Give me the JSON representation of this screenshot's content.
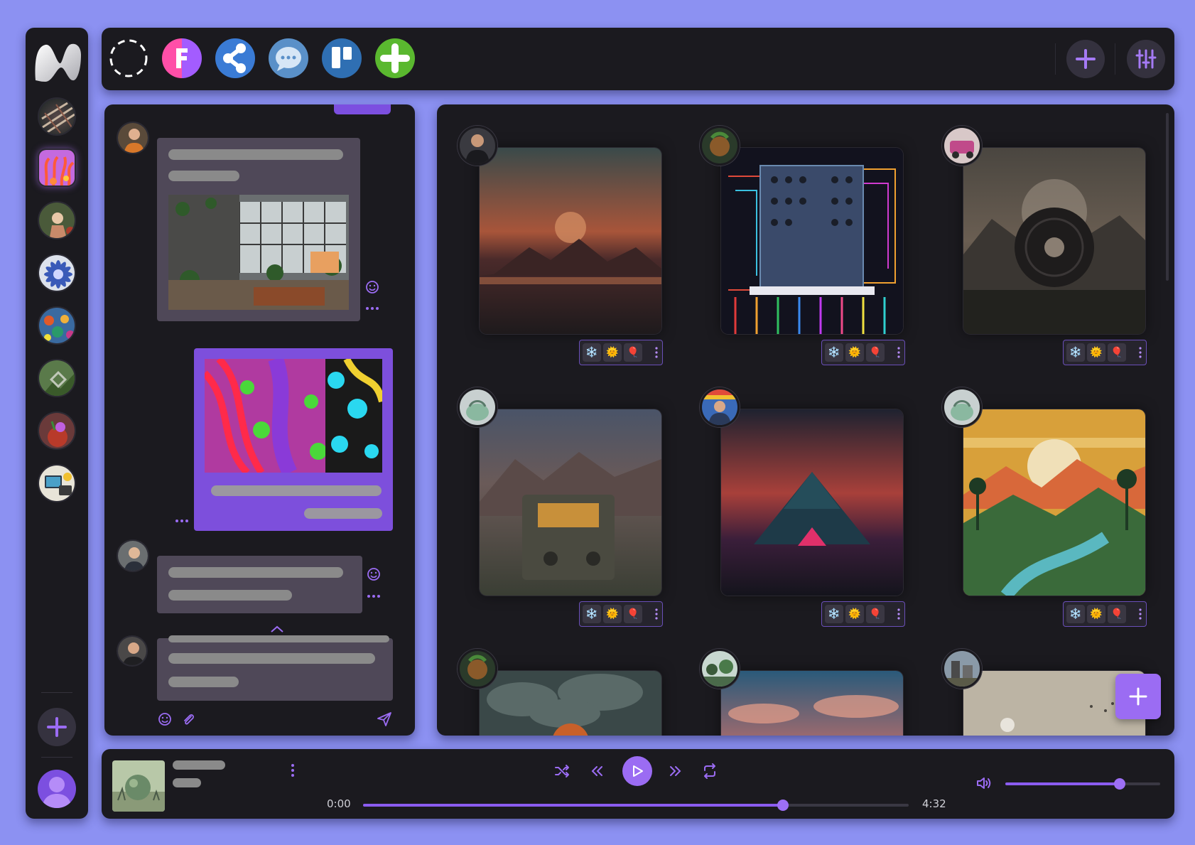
{
  "colors": {
    "background": "#8c91f2",
    "panel": "#1b1a1f",
    "accent": "#8b5cf0",
    "bubble": "#4f4858",
    "own_bubble": "#7d4fdc"
  },
  "sidebar": {
    "logo": "app-logo-icon",
    "servers": [
      {
        "name": "server-1",
        "active": false
      },
      {
        "name": "server-2",
        "active": true
      },
      {
        "name": "server-3",
        "active": false
      },
      {
        "name": "server-4",
        "active": false
      },
      {
        "name": "server-5",
        "active": false
      },
      {
        "name": "server-6",
        "active": false
      },
      {
        "name": "server-7",
        "active": false
      },
      {
        "name": "server-8",
        "active": false
      }
    ],
    "add_icon": "plus-icon",
    "user_icon": "user-icon"
  },
  "topbar": {
    "apps": [
      "dashed-circle-icon",
      "figma-like-icon",
      "share-icon",
      "chat-icon",
      "trello-like-icon",
      "add-app-icon"
    ],
    "actions": [
      "plus-icon",
      "sliders-icon"
    ]
  },
  "chat": {
    "composer_icons": [
      "emoji-icon",
      "attach-icon",
      "send-icon"
    ]
  },
  "gallery": {
    "reactions": [
      "❄️",
      "🌞",
      "🎈"
    ],
    "cards": [
      {
        "title": "sunset-mountains"
      },
      {
        "title": "synth-hologram"
      },
      {
        "title": "vinyl-moon"
      },
      {
        "title": "retro-radio"
      },
      {
        "title": "neon-pyramid"
      },
      {
        "title": "tropical-sunset"
      },
      {
        "title": "cloudy-sky"
      },
      {
        "title": "pastel-clouds"
      },
      {
        "title": "desert-sphere"
      }
    ]
  },
  "player": {
    "elapsed": "0:00",
    "duration": "4:32",
    "progress": 0.77,
    "volume": 0.74
  }
}
